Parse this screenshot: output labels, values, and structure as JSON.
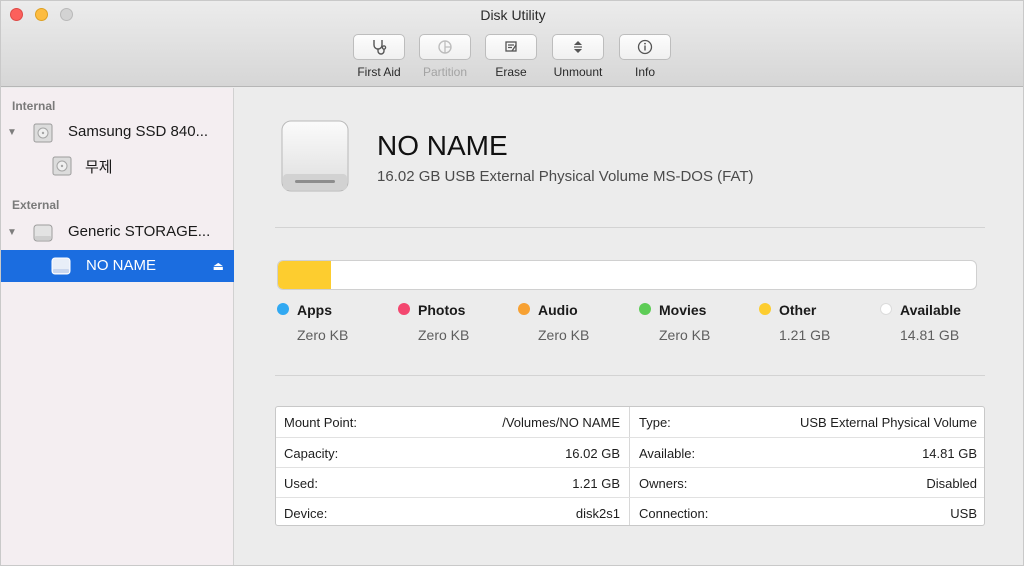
{
  "window": {
    "title": "Disk Utility"
  },
  "toolbar": {
    "first_aid": "First Aid",
    "partition": "Partition",
    "erase": "Erase",
    "unmount": "Unmount",
    "info": "Info"
  },
  "sidebar": {
    "internal_label": "Internal",
    "external_label": "External",
    "items": [
      {
        "label": "Samsung SSD 840..."
      },
      {
        "label": "무제"
      },
      {
        "label": "Generic STORAGE..."
      },
      {
        "label": "NO NAME"
      }
    ]
  },
  "volume": {
    "name": "NO NAME",
    "description": "16.02 GB USB External Physical Volume MS-DOS (FAT)"
  },
  "usage": {
    "used_fraction": 0.076,
    "used_color": "#fdcd2f",
    "legend": [
      {
        "label": "Apps",
        "value": "Zero KB",
        "color": "#31a9f2"
      },
      {
        "label": "Photos",
        "value": "Zero KB",
        "color": "#f3476f"
      },
      {
        "label": "Audio",
        "value": "Zero KB",
        "color": "#f7a133"
      },
      {
        "label": "Movies",
        "value": "Zero KB",
        "color": "#5dcc56"
      },
      {
        "label": "Other",
        "value": "1.21 GB",
        "color": "#fdcd2f"
      },
      {
        "label": "Available",
        "value": "14.81 GB",
        "color": "#ffffff"
      }
    ]
  },
  "details": {
    "left": [
      {
        "key": "Mount Point:",
        "value": "/Volumes/NO NAME"
      },
      {
        "key": "Capacity:",
        "value": "16.02 GB"
      },
      {
        "key": "Used:",
        "value": "1.21 GB"
      },
      {
        "key": "Device:",
        "value": "disk2s1"
      }
    ],
    "right": [
      {
        "key": "Type:",
        "value": "USB External Physical Volume"
      },
      {
        "key": "Available:",
        "value": "14.81 GB"
      },
      {
        "key": "Owners:",
        "value": "Disabled"
      },
      {
        "key": "Connection:",
        "value": "USB"
      }
    ]
  }
}
